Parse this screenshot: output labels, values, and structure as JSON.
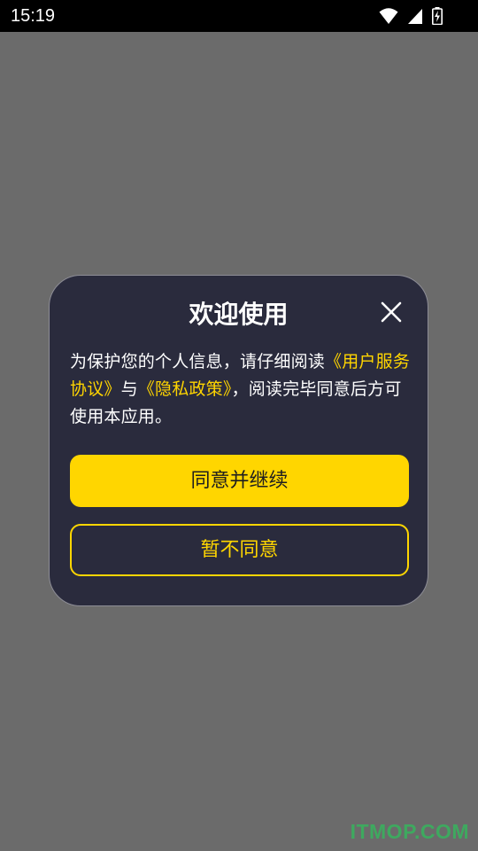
{
  "status_bar": {
    "time": "15:19",
    "icons": [
      "wifi-icon",
      "signal-icon",
      "battery-charging-icon"
    ]
  },
  "dialog": {
    "title": "欢迎使用",
    "close_icon": "close-icon",
    "body": {
      "text_1": "为保护您的个人信息，请仔细阅读",
      "user_agreement_link": "《用户服务协议》",
      "text_2": "与",
      "privacy_policy_link": "《隐私政策》",
      "text_3": "，阅读完毕同意后方可使用本应用。"
    },
    "agree_button": "同意并继续",
    "decline_button": "暂不同意"
  },
  "watermark": "ITMOP.COM",
  "colors": {
    "accent": "#ffd600",
    "dialog_bg": "#2a2b3d",
    "overlay": "#6b6b6b"
  }
}
